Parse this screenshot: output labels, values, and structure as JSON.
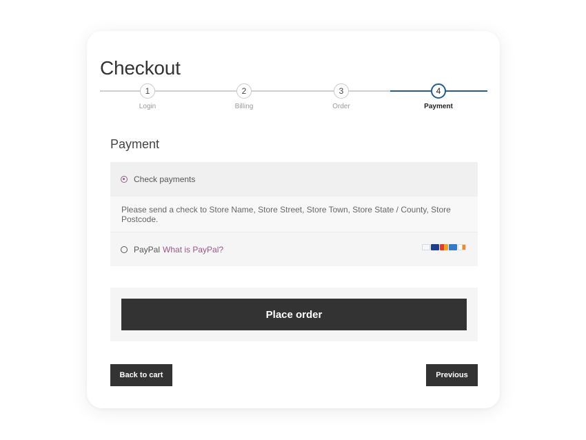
{
  "page": {
    "title": "Checkout"
  },
  "stepper": {
    "steps": [
      {
        "number": "1",
        "label": "Login"
      },
      {
        "number": "2",
        "label": "Billing"
      },
      {
        "number": "3",
        "label": "Order"
      },
      {
        "number": "4",
        "label": "Payment"
      }
    ],
    "active_step": 4,
    "colors": {
      "active": "#1e5aa0",
      "inactive": "#cfcfcf"
    }
  },
  "payment": {
    "heading": "Payment",
    "methods": [
      {
        "label": "Check payments",
        "selected": true,
        "description": "Please send a check to Store Name, Store Street, Store Town, Store State / County, Store Postcode."
      },
      {
        "label": "PayPal",
        "link_text": "What is PayPal?",
        "selected": false,
        "card_icons": [
          "paypal-icon",
          "visa-icon",
          "mastercard-icon",
          "amex-icon",
          "discover-icon"
        ]
      }
    ],
    "accent_color": "#96588a"
  },
  "actions": {
    "place_order": "Place order",
    "back_to_cart": "Back to cart",
    "previous": "Previous"
  }
}
